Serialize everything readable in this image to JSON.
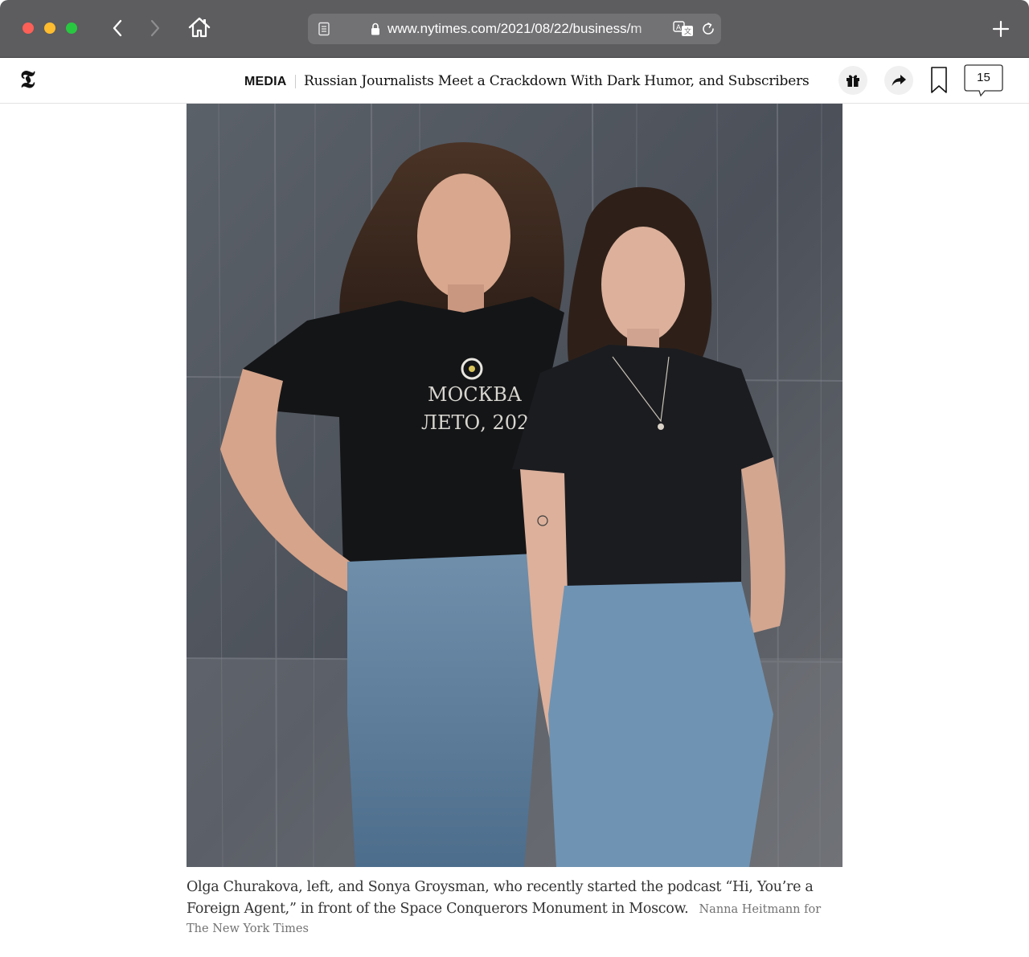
{
  "browser": {
    "url": "www.nytimes.com/2021/08/22/business/m",
    "icons": [
      "back-icon",
      "forward-icon",
      "home-icon",
      "reader-icon",
      "lock-icon",
      "translate-icon",
      "reload-icon",
      "plus-icon"
    ]
  },
  "header": {
    "logo": "𝕿",
    "section": "MEDIA",
    "headline": "Russian Journalists Meet a Crackdown With Dark Humor, and Subscribers",
    "comment_count": "15",
    "icons": [
      "gift-icon",
      "share-icon",
      "bookmark-icon",
      "comment-icon"
    ]
  },
  "photo": {
    "shirt_text_line1": "МОСКВА",
    "shirt_text_line2": "ЛЕТО, 2021"
  },
  "caption": {
    "text": "Olga Churakova, left, and Sonya Groysman, who recently started the podcast “Hi, You’re a Foreign Agent,” in front of the Space Conquerors Monument in Moscow.",
    "credit": "Nanna Heitmann for The New York Times"
  },
  "colors": {
    "titlebar": "#5d5c5e",
    "addressbar": "#727174",
    "close": "#fe5f57",
    "minimize": "#febc2e",
    "zoom": "#28c840"
  }
}
